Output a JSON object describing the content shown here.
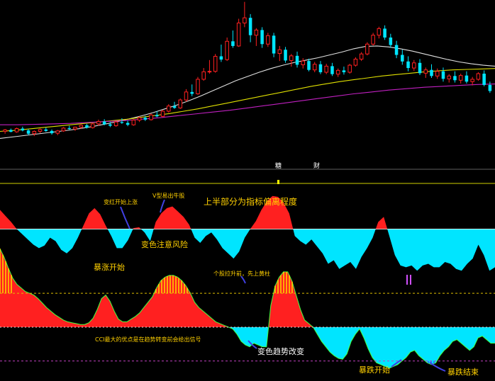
{
  "colors": {
    "bg": "#000000",
    "up": "#ff2020",
    "down": "#00e5ff",
    "ma_white": "#e0e0e0",
    "ma_yellow": "#e0e000",
    "ma_purple": "#c020c0",
    "ann_yellow": "#ffd000",
    "ann_white": "#ffffff",
    "stripe": "#ffd000",
    "dash_yellow": "#e0c000",
    "dash_white": "#dddddd",
    "pointer": "#4040e0",
    "curve_green": "#40ff40"
  },
  "markers": {
    "m1": "糖",
    "m2": "财"
  },
  "chart_data": [
    {
      "type": "candlestick",
      "title": "",
      "candles": [
        [
          42,
          42.5,
          41.5,
          42.3
        ],
        [
          42.3,
          42.6,
          41.8,
          41.9
        ],
        [
          41.9,
          42.8,
          41.7,
          42.6
        ],
        [
          42.6,
          43,
          42,
          42.2
        ],
        [
          42.2,
          42.5,
          41.2,
          41.5
        ],
        [
          41.5,
          42.2,
          41,
          42
        ],
        [
          42,
          42.6,
          41.6,
          42.4
        ],
        [
          42.4,
          42.8,
          41.9,
          42.1
        ],
        [
          42.1,
          42.4,
          41.3,
          41.6
        ],
        [
          41.6,
          42.3,
          41.2,
          42.1
        ],
        [
          42.1,
          42.9,
          41.9,
          42.7
        ],
        [
          42.7,
          43.2,
          42.3,
          42.5
        ],
        [
          42.5,
          43,
          42.1,
          42.9
        ],
        [
          42.9,
          43.5,
          42.5,
          43.3
        ],
        [
          43.3,
          43.6,
          42.6,
          42.8
        ],
        [
          42.8,
          43.8,
          42.6,
          43.6
        ],
        [
          43.6,
          44.5,
          43.2,
          44.1
        ],
        [
          44.1,
          44.6,
          43.3,
          43.5
        ],
        [
          43.5,
          44,
          42.9,
          43.2
        ],
        [
          43.2,
          44.2,
          43,
          44
        ],
        [
          44,
          44.8,
          43.6,
          43.8
        ],
        [
          43.8,
          44.3,
          43.1,
          43.4
        ],
        [
          43.4,
          44.6,
          43.2,
          44.4
        ],
        [
          44.4,
          45.2,
          44,
          44.9
        ],
        [
          44.9,
          45.3,
          44.2,
          44.5
        ],
        [
          44.5,
          45.8,
          44.3,
          45.5
        ],
        [
          45.5,
          46.3,
          45,
          45.2
        ],
        [
          45.2,
          46.6,
          45,
          46.3
        ],
        [
          46.3,
          47.8,
          46,
          47.4
        ],
        [
          47.4,
          48.3,
          46.8,
          47
        ],
        [
          47,
          49,
          46.8,
          48.7
        ],
        [
          48.7,
          51,
          48.3,
          50.4
        ],
        [
          50.4,
          52,
          49.5,
          50
        ],
        [
          50,
          53.6,
          49.8,
          53.1
        ],
        [
          53.1,
          55.5,
          52.8,
          54.7
        ],
        [
          54.7,
          57.2,
          54.3,
          54.8
        ],
        [
          54.8,
          58.5,
          54.5,
          58
        ],
        [
          58,
          60.5,
          56.8,
          57.3
        ],
        [
          57.3,
          62,
          57,
          61.2
        ],
        [
          61.2,
          63.5,
          59.8,
          60.2
        ],
        [
          60.2,
          66,
          60,
          65.1
        ],
        [
          65.1,
          69.6,
          64.2,
          66.2
        ],
        [
          66.2,
          67,
          61,
          62.5
        ],
        [
          62.5,
          64,
          60.2,
          63.6
        ],
        [
          63.6,
          64.2,
          59.8,
          60.6
        ],
        [
          60.6,
          63,
          60,
          62.4
        ],
        [
          62.4,
          63,
          57.8,
          58.6
        ],
        [
          58.6,
          60.2,
          57,
          59.4
        ],
        [
          59.4,
          60,
          56.6,
          57.1
        ],
        [
          57.1,
          58.5,
          55.8,
          58.1
        ],
        [
          58.1,
          59,
          55.6,
          56.2
        ],
        [
          56.2,
          57.6,
          55.4,
          57
        ],
        [
          57,
          57.5,
          54.8,
          55.1
        ],
        [
          55.1,
          56.8,
          54.6,
          56.3
        ],
        [
          56.3,
          57,
          54.2,
          54.6
        ],
        [
          54.6,
          56.4,
          54.2,
          55.9
        ],
        [
          55.9,
          56.6,
          53.8,
          54.2
        ],
        [
          54.2,
          55.4,
          53.6,
          55
        ],
        [
          55,
          55.8,
          54.1,
          54.6
        ],
        [
          54.6,
          56.4,
          54.3,
          56.1
        ],
        [
          56.1,
          57.8,
          55.8,
          57.4
        ],
        [
          57.4,
          58.9,
          57,
          58.5
        ],
        [
          58.5,
          61,
          58.2,
          60.6
        ],
        [
          60.6,
          63,
          60.3,
          62.5
        ],
        [
          62.5,
          64.3,
          61.8,
          63.9
        ],
        [
          63.9,
          64.6,
          61.5,
          62
        ],
        [
          62,
          62.8,
          59.8,
          60.4
        ],
        [
          60.4,
          61.3,
          57.6,
          58.3
        ],
        [
          58.3,
          59.4,
          56.2,
          56.9
        ],
        [
          56.9,
          58,
          54.8,
          55.5
        ],
        [
          55.5,
          57.2,
          54.9,
          56.6
        ],
        [
          56.6,
          57.4,
          54,
          54.4
        ],
        [
          54.4,
          55.6,
          53.4,
          55.1
        ],
        [
          55.1,
          56.3,
          53.4,
          53.8
        ],
        [
          53.8,
          55.4,
          53.2,
          54.8
        ],
        [
          54.8,
          55.6,
          52.6,
          53.2
        ],
        [
          53.2,
          54.2,
          52.4,
          53.8
        ],
        [
          53.8,
          54.8,
          52.4,
          52.9
        ],
        [
          52.9,
          54.3,
          52.2,
          53.9
        ],
        [
          53.9,
          54.8,
          52.2,
          52.6
        ],
        [
          52.6,
          53.6,
          51.8,
          53.1
        ],
        [
          53.1,
          54.6,
          52.8,
          54.3
        ],
        [
          54.3,
          55,
          51.6,
          51.9
        ],
        [
          51.9,
          52.6,
          50.2,
          50.6
        ]
      ],
      "ma": [
        {
          "name": "",
          "color": "#e0e0e0",
          "values": [
            40.5,
            40.8,
            41.1,
            41.4,
            41.7,
            42,
            42.3,
            42.7,
            43.1,
            43.6,
            44.1,
            44.7,
            45.3,
            46,
            46.8,
            47.6,
            48.5,
            49.5,
            50.6,
            51.7,
            52.8,
            53.7,
            54.6,
            55.4,
            56.1,
            56.7,
            57.2,
            57.7,
            58.3,
            58.9,
            59.6,
            60.1,
            60.2,
            60,
            59.6,
            59.1,
            58.5,
            57.9,
            57.3,
            56.8,
            56.4,
            56.1,
            55.9
          ]
        },
        {
          "name": "",
          "color": "#e0e000",
          "values": [
            42,
            42.2,
            42.5,
            42.8,
            43.1,
            43.4,
            43.7,
            44,
            44.3,
            44.6,
            45,
            45.4,
            45.8,
            46.3,
            46.8,
            47.4,
            48,
            48.6,
            49.2,
            49.8,
            50.4,
            51,
            51.6,
            52.1,
            52.6,
            53,
            53.4,
            53.8,
            54.1,
            54.4,
            54.7,
            54.9,
            55.1,
            55.2,
            55.3,
            55.4
          ]
        },
        {
          "name": "",
          "color": "#c020c0",
          "values": [
            43.4,
            43.4,
            43.5,
            43.6,
            43.7,
            43.9,
            44.1,
            44.3,
            44.6,
            44.9,
            45.3,
            45.7,
            46.1,
            46.5,
            47,
            47.5,
            48,
            48.5,
            49,
            49.5,
            50,
            50.4,
            50.8,
            51.1,
            51.4,
            51.6,
            51.8,
            52,
            52.1
          ]
        }
      ],
      "ylim": [
        38,
        70
      ]
    },
    {
      "type": "area",
      "title": "",
      "baseline": 0,
      "values": [
        22,
        15,
        8,
        0,
        -6,
        -12,
        -18,
        -22,
        -19,
        -10,
        -14,
        -24,
        -28,
        -22,
        -10,
        4,
        18,
        24,
        17,
        4,
        -8,
        -22,
        -22,
        -13,
        1,
        2,
        -4,
        -14,
        8,
        18,
        24,
        26,
        20,
        14,
        5,
        -10,
        -16,
        -8,
        -4,
        -12,
        -22,
        -28,
        -34,
        -26,
        -10,
        0,
        9,
        22,
        32,
        38,
        37,
        30,
        18,
        -8,
        -14,
        -18,
        -12,
        -20,
        -28,
        -40,
        -36,
        -46,
        -42,
        -38,
        -46,
        -32,
        -22,
        -10,
        8,
        14,
        -8,
        -30,
        -42,
        -44,
        -42,
        -48,
        -42,
        -40,
        -44,
        -44,
        -38,
        -40,
        -46,
        -48,
        -40,
        -34,
        -18,
        -30,
        -48,
        -44
      ],
      "ylim": [
        -60,
        50
      ]
    },
    {
      "type": "area",
      "title": "",
      "baseline": 0,
      "values": [
        88,
        78,
        66,
        55,
        48,
        44,
        40,
        38,
        36,
        32,
        27,
        22,
        18,
        14,
        11,
        8,
        6,
        5,
        4,
        3,
        3,
        5,
        10,
        20,
        32,
        36,
        29,
        18,
        9,
        6,
        6,
        9,
        12,
        16,
        22,
        28,
        34,
        44,
        52,
        56,
        58,
        58,
        56,
        52,
        46,
        38,
        28,
        22,
        18,
        14,
        10,
        6,
        4,
        2,
        0,
        -2,
        -8,
        -16,
        -20,
        -22,
        -18,
        -20,
        -22,
        -22,
        24,
        46,
        56,
        62,
        62,
        52,
        36,
        20,
        8,
        4,
        0,
        -8,
        -16,
        -22,
        -28,
        -32,
        -35,
        -36,
        -30,
        -16,
        -8,
        -2,
        -12,
        -24,
        -34,
        -40,
        -42,
        -44,
        -46,
        -44,
        -42,
        -38,
        -34,
        -28,
        -26,
        -32,
        -36,
        -40,
        -42,
        -40,
        -32,
        -26,
        -22,
        -16,
        -14,
        -18,
        -22,
        -26,
        -22,
        -12,
        -10,
        -14,
        -18,
        -18
      ],
      "ylim": [
        -58,
        100
      ]
    }
  ],
  "annotations": [
    {
      "text": "变红开始上涨",
      "color": "#ffd000",
      "size": "small"
    },
    {
      "text": "V型易出牛股",
      "color": "#ffd000",
      "size": "small"
    },
    {
      "text": "上半部分为指标偏离程度",
      "color": "#ffd000",
      "size": "big"
    },
    {
      "text": "变色注意风险",
      "color": "#ffd000",
      "size": "mid"
    },
    {
      "text": "暴涨开始",
      "color": "#ffd000",
      "size": "mid"
    },
    {
      "text": "个股拉升前，先上黄柱",
      "color": "#ffd000",
      "size": "small"
    },
    {
      "text": "CCI最大的优点是在趋势转变前会给出信号",
      "color": "#ffd000",
      "size": "small"
    },
    {
      "text": "变色趋势改变",
      "color": "#ffffff",
      "size": "mid"
    },
    {
      "text": "暴跌开始",
      "color": "#ffd000",
      "size": "mid"
    },
    {
      "text": "暴跌结束",
      "color": "#ffd000",
      "size": "mid"
    }
  ]
}
